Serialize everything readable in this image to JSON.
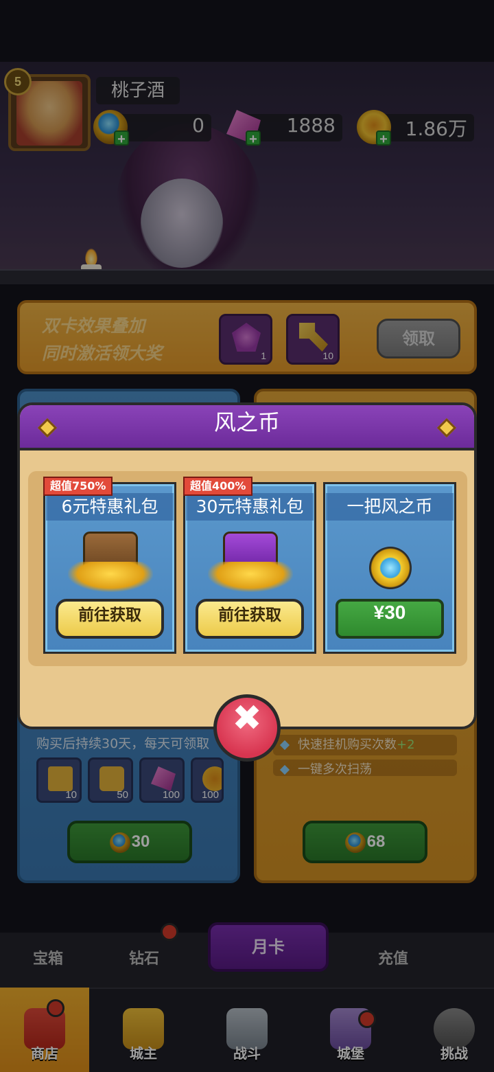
{
  "player": {
    "name": "桃子酒",
    "level": "5"
  },
  "currencies": [
    {
      "icon": "blue-coin-icon",
      "value": "0"
    },
    {
      "icon": "gem-icon",
      "value": "1888"
    },
    {
      "icon": "gold-coin-icon",
      "value": "1.86万"
    }
  ],
  "banner": {
    "line1": "双卡效果叠加",
    "line2": "同时激活领大奖",
    "items": [
      {
        "icon": "crystal-icon",
        "count": "1"
      },
      {
        "icon": "key-icon",
        "count": "10"
      }
    ],
    "claim_label": "领取"
  },
  "month_cards": {
    "left": {
      "note": "购买后持续30天，每天可领取",
      "rewards": [
        {
          "icon": "ticket-icon",
          "count": "10"
        },
        {
          "icon": "puzzle-icon",
          "count": "50"
        },
        {
          "icon": "gem-icon",
          "count": "100"
        },
        {
          "icon": "gold-coin-icon",
          "count": "100"
        }
      ],
      "price": "30"
    },
    "right": {
      "perks": [
        {
          "text": "快速挂机购买次数",
          "bonus": "+2"
        },
        {
          "text": "一键多次扫荡",
          "bonus": ""
        }
      ],
      "price": "68"
    }
  },
  "modal": {
    "title": "风之币",
    "offers": [
      {
        "tag": "超值750%",
        "title": "6元特惠礼包",
        "button": "前往获取"
      },
      {
        "tag": "超值400%",
        "title": "30元特惠礼包",
        "button": "前往获取"
      },
      {
        "tag": "",
        "title": "一把风之币",
        "button": "¥30"
      }
    ]
  },
  "shop_tabs": {
    "items": [
      "宝箱",
      "钻石",
      "月卡",
      "充值"
    ],
    "active": "月卡"
  },
  "nav": {
    "items": [
      "商店",
      "城主",
      "战斗",
      "城堡",
      "挑战"
    ],
    "active": "商店"
  },
  "colors": {
    "modal_header": "#7a36a8",
    "accent_gold": "#f0b445",
    "offer_blue": "#4f8ec6",
    "close_red": "#e0465e"
  }
}
